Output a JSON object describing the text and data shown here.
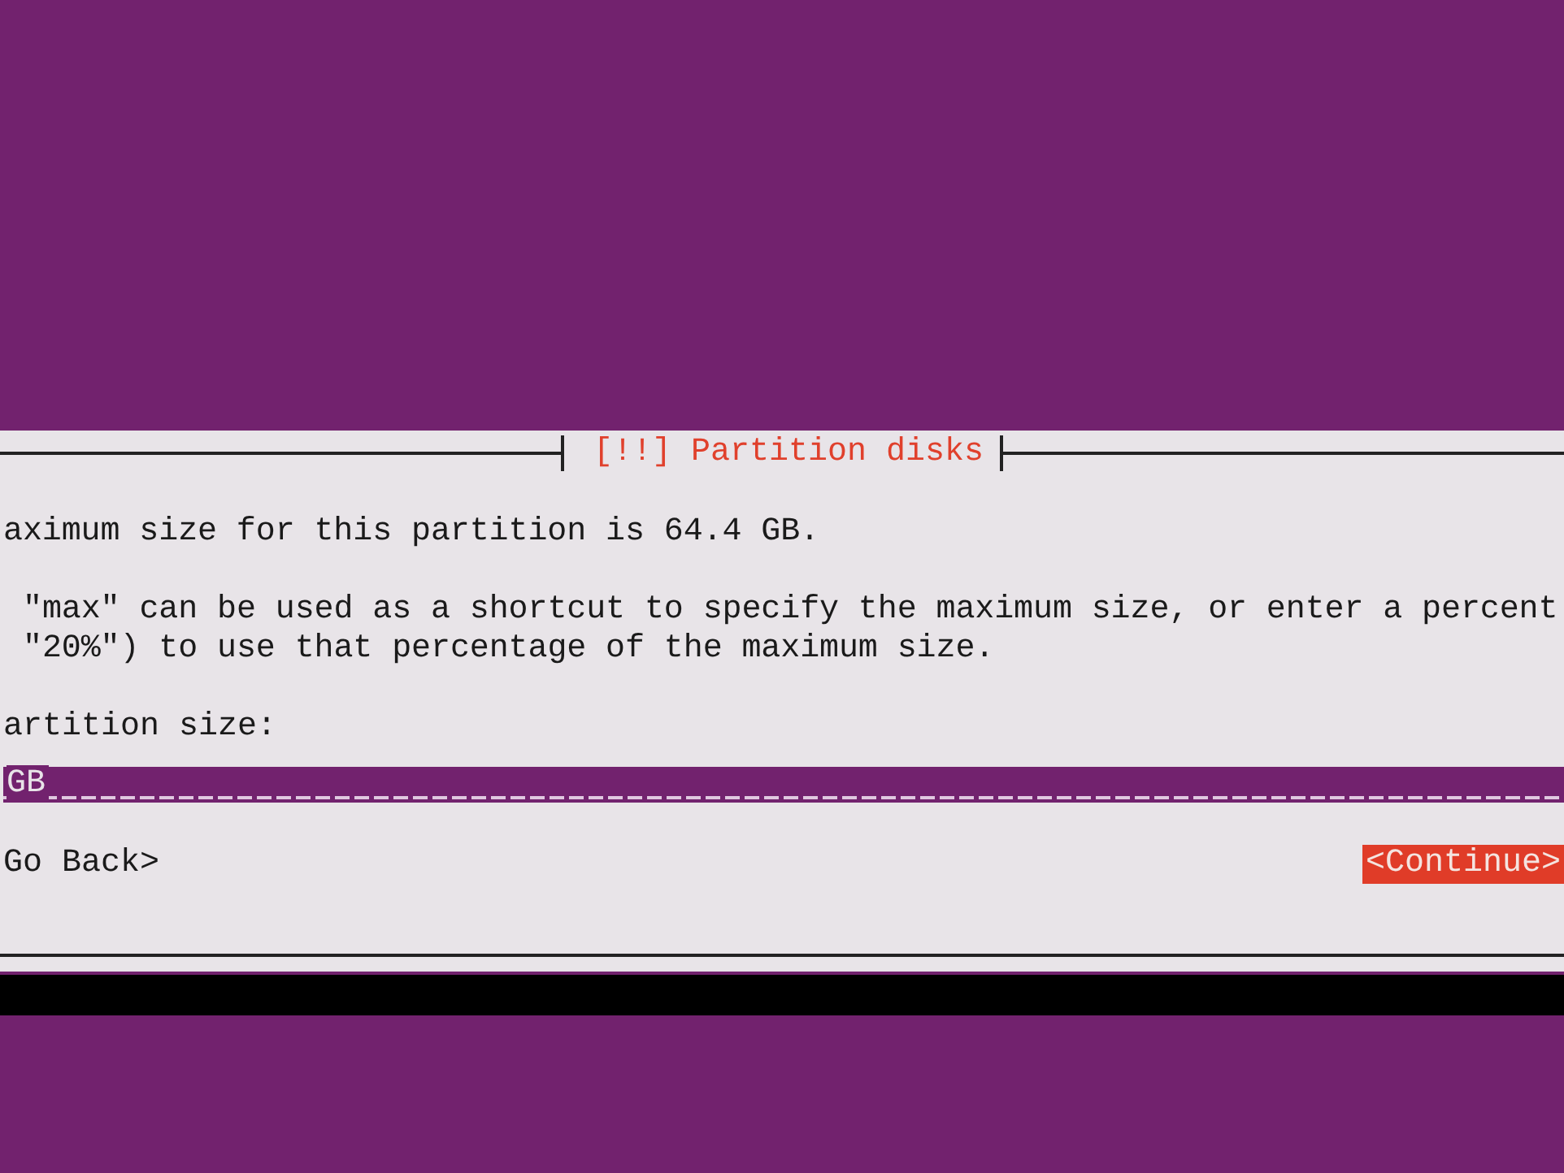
{
  "dialog": {
    "title": "[!!] Partition disks",
    "paragraphs": [
      [
        "aximum size for this partition is 64.4 GB."
      ],
      [
        "\"max\" can be used as a shortcut to specify the maximum size, or enter a percent",
        "\"20%\") to use that percentage of the maximum size."
      ]
    ],
    "prompt": "artition size:",
    "field": {
      "value": "GB"
    },
    "buttons": [
      {
        "label": "Go Back>",
        "selected": false
      },
      {
        "label": "<Continue>",
        "selected": true
      }
    ]
  }
}
